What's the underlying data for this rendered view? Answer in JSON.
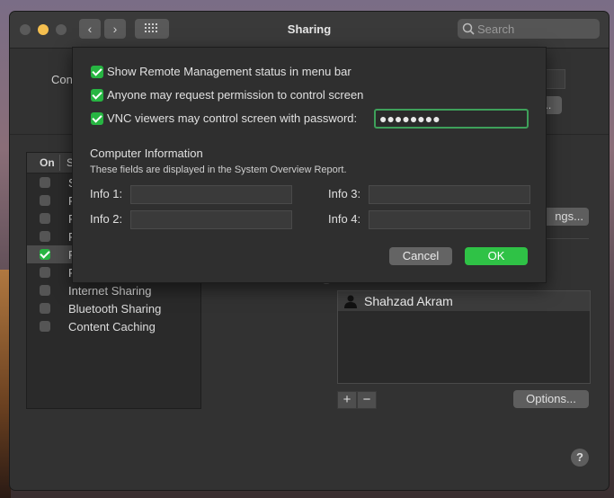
{
  "window": {
    "title": "Sharing",
    "search_placeholder": "Search",
    "back_glyph": "‹",
    "forward_glyph": "›"
  },
  "background": {
    "computer_name_label": "Con",
    "edit_button": "...",
    "settings_button_partial": "ngs...",
    "services_header": {
      "on": "On",
      "service": "S"
    },
    "services": [
      {
        "label": "S",
        "checked": false
      },
      {
        "label": "F",
        "checked": false
      },
      {
        "label": "F",
        "checked": false
      },
      {
        "label": "F",
        "checked": false
      },
      {
        "label": "F",
        "checked": true,
        "selected": true
      },
      {
        "label": "F",
        "checked": false
      },
      {
        "label": "Internet Sharing",
        "checked": false
      },
      {
        "label": "Bluetooth Sharing",
        "checked": false
      },
      {
        "label": "Content Caching",
        "checked": false
      }
    ],
    "users": [
      "Shahzad Akram"
    ],
    "add_button": "+",
    "remove_button": "−",
    "options_button": "Options...",
    "help_button": "?"
  },
  "sheet": {
    "checkboxes": [
      {
        "label": "Show Remote Management status in menu bar",
        "checked": true
      },
      {
        "label": "Anyone may request permission to control screen",
        "checked": true
      },
      {
        "label": "VNC viewers may control screen with password:",
        "checked": true
      }
    ],
    "password_value": "●●●●●●●●",
    "computer_info_title": "Computer Information",
    "computer_info_subtitle": "These fields are displayed in the System Overview Report.",
    "info_fields": [
      {
        "label": "Info 1:",
        "value": ""
      },
      {
        "label": "Info 2:",
        "value": ""
      },
      {
        "label": "Info 3:",
        "value": ""
      },
      {
        "label": "Info 4:",
        "value": ""
      }
    ],
    "cancel_button": "Cancel",
    "ok_button": "OK"
  },
  "colors": {
    "accent_green": "#2fc246",
    "checkbox_green": "#27b542",
    "focus_ring": "#3ea05a"
  }
}
